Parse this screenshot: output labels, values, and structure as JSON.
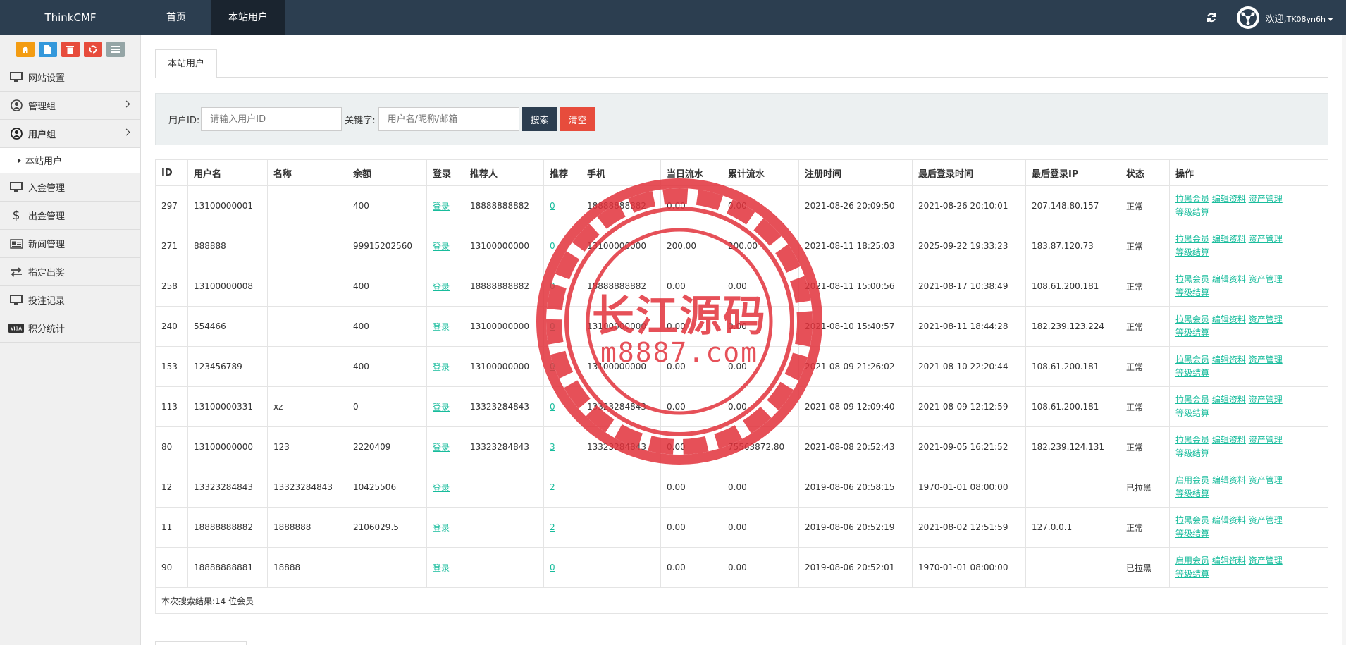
{
  "header": {
    "brand": "ThinkCMF",
    "nav": [
      "首页",
      "本站用户"
    ],
    "welcome": "欢迎,",
    "username": "TK08yn6h"
  },
  "sidebar": {
    "shortcut_icons": [
      "home-icon",
      "file-icon",
      "trash-icon",
      "recycle-icon",
      "list-icon"
    ],
    "items": [
      {
        "label": "网站设置",
        "icon": "monitor-icon"
      },
      {
        "label": "管理组",
        "icon": "user-circle-icon"
      },
      {
        "label": "用户组",
        "icon": "user-circle-icon"
      },
      {
        "label": "入金管理",
        "icon": "monitor-icon"
      },
      {
        "label": "出金管理",
        "icon": "dollar-icon"
      },
      {
        "label": "新闻管理",
        "icon": "newspaper-icon"
      },
      {
        "label": "指定出奖",
        "icon": "exchange-icon"
      },
      {
        "label": "投注记录",
        "icon": "monitor-icon"
      },
      {
        "label": "积分统计",
        "icon": "visa-icon"
      }
    ],
    "subitem": "本站用户"
  },
  "tab": "本站用户",
  "filter": {
    "id_label": "用户ID:",
    "id_placeholder": "请输入用户ID",
    "kw_label": "关键字:",
    "kw_placeholder": "用户名/昵称/邮箱",
    "search": "搜索",
    "clear": "清空"
  },
  "table": {
    "headers": [
      "ID",
      "用户名",
      "名称",
      "余额",
      "登录",
      "推荐人",
      "推荐",
      "手机",
      "当日流水",
      "累计流水",
      "注册时间",
      "最后登录时间",
      "最后登录IP",
      "状态",
      "操作"
    ],
    "login_link": "登录",
    "ops": {
      "block": "拉黑会员",
      "enable": "启用会员",
      "edit": "编辑资料",
      "asset": "资产管理",
      "settle": "等级结算"
    },
    "rows": [
      {
        "id": "297",
        "user": "13100000001",
        "name": "",
        "balance": "400",
        "referrer": "18888888882",
        "ref": "0",
        "phone": "18888888882",
        "today": "0.00",
        "total": "0.00",
        "reg": "2021-08-26 20:09:50",
        "last": "2021-08-26 20:10:01",
        "ip": "207.148.80.157",
        "status": "正常",
        "blocked": false
      },
      {
        "id": "271",
        "user": "888888",
        "name": "",
        "balance": "99915202560",
        "referrer": "13100000000",
        "ref": "0",
        "phone": "13100000000",
        "today": "200.00",
        "total": "200.00",
        "reg": "2021-08-11 18:25:03",
        "last": "2025-09-22 19:33:23",
        "ip": "183.87.120.73",
        "status": "正常",
        "blocked": false
      },
      {
        "id": "258",
        "user": "13100000008",
        "name": "",
        "balance": "400",
        "referrer": "18888888882",
        "ref": "0",
        "phone": "18888888882",
        "today": "0.00",
        "total": "0.00",
        "reg": "2021-08-11 15:00:56",
        "last": "2021-08-17 10:38:49",
        "ip": "108.61.200.181",
        "status": "正常",
        "blocked": false
      },
      {
        "id": "240",
        "user": "554466",
        "name": "",
        "balance": "400",
        "referrer": "13100000000",
        "ref": "0",
        "phone": "13100000000",
        "today": "0.00",
        "total": "0.00",
        "reg": "2021-08-10 15:40:57",
        "last": "2021-08-11 18:44:28",
        "ip": "182.239.123.224",
        "status": "正常",
        "blocked": false
      },
      {
        "id": "153",
        "user": "123456789",
        "name": "",
        "balance": "400",
        "referrer": "13100000000",
        "ref": "0",
        "phone": "13100000000",
        "today": "0.00",
        "total": "0.00",
        "reg": "2021-08-09 21:26:02",
        "last": "2021-08-10 22:20:44",
        "ip": "108.61.200.181",
        "status": "正常",
        "blocked": false
      },
      {
        "id": "113",
        "user": "13100000331",
        "name": "xz",
        "balance": "0",
        "referrer": "13323284843",
        "ref": "0",
        "phone": "13323284843",
        "today": "0.00",
        "total": "0.00",
        "reg": "2021-08-09 12:09:40",
        "last": "2021-08-09 12:12:59",
        "ip": "108.61.200.181",
        "status": "正常",
        "blocked": false
      },
      {
        "id": "80",
        "user": "13100000000",
        "name": "123",
        "balance": "2220409",
        "referrer": "13323284843",
        "ref": "3",
        "phone": "13323284843",
        "today": "0.00",
        "total": "75563872.80",
        "reg": "2021-08-08 20:52:43",
        "last": "2021-09-05 16:21:52",
        "ip": "182.239.124.131",
        "status": "正常",
        "blocked": false
      },
      {
        "id": "12",
        "user": "13323284843",
        "name": "13323284843",
        "balance": "10425506",
        "referrer": "",
        "ref": "2",
        "phone": "",
        "today": "0.00",
        "total": "0.00",
        "reg": "2019-08-06 20:58:15",
        "last": "1970-01-01 08:00:00",
        "ip": "",
        "status": "已拉黑",
        "blocked": true
      },
      {
        "id": "11",
        "user": "18888888882",
        "name": "1888888",
        "balance": "2106029.5",
        "referrer": "",
        "ref": "2",
        "phone": "",
        "today": "0.00",
        "total": "0.00",
        "reg": "2019-08-06 20:52:19",
        "last": "2021-08-02 12:51:59",
        "ip": "127.0.0.1",
        "status": "正常",
        "blocked": false
      },
      {
        "id": "90",
        "user": "18888888881",
        "name": "18888",
        "balance": "",
        "referrer": "",
        "ref": "0",
        "phone": "",
        "today": "0.00",
        "total": "0.00",
        "reg": "2019-08-06 20:52:01",
        "last": "1970-01-01 08:00:00",
        "ip": "",
        "status": "已拉黑",
        "blocked": true
      }
    ],
    "summary": "本次搜索结果:14 位会员"
  },
  "watermark": {
    "line1": "长江源码",
    "line2": "m8887.com",
    "color": "#e2323c"
  }
}
